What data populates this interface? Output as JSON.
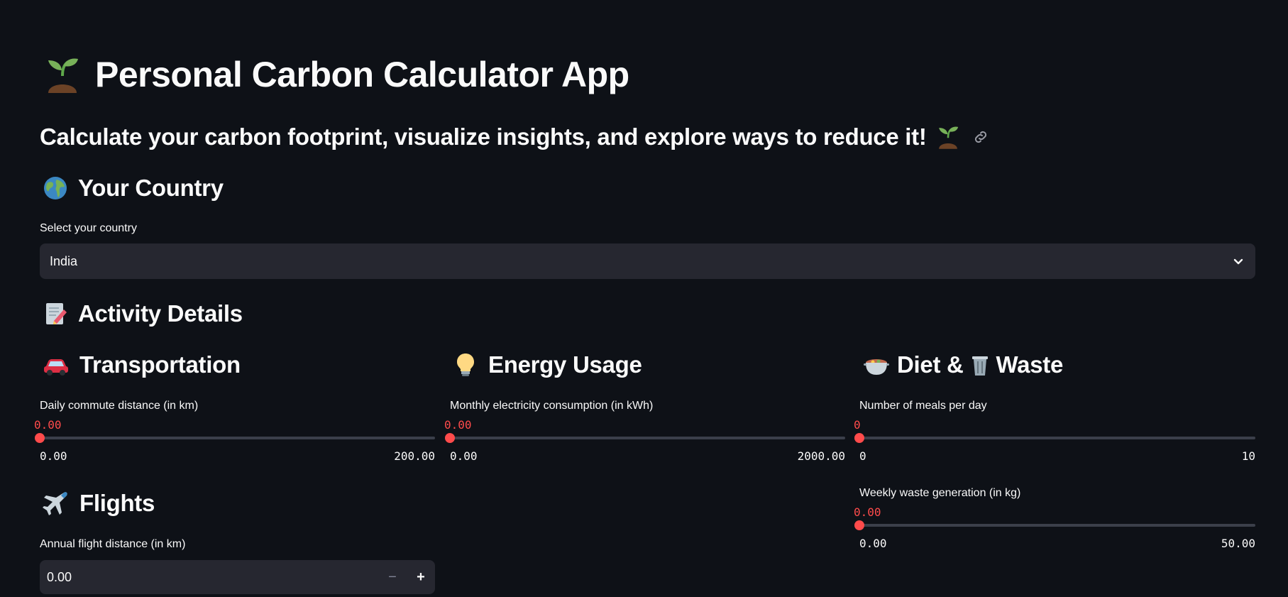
{
  "header": {
    "title": "Personal Carbon Calculator App",
    "subtitle": "Calculate your carbon footprint, visualize insights, and explore ways to reduce it!"
  },
  "country": {
    "heading": "Your Country",
    "label": "Select your country",
    "selected": "India"
  },
  "activity": {
    "heading": "Activity Details"
  },
  "transportation": {
    "heading": "Transportation",
    "label": "Daily commute distance (in km)",
    "value": "0.00",
    "min": "0.00",
    "max": "200.00",
    "fraction": 0
  },
  "energy": {
    "heading": "Energy Usage",
    "label": "Monthly electricity consumption (in kWh)",
    "value": "0.00",
    "min": "0.00",
    "max": "2000.00",
    "fraction": 0
  },
  "diet": {
    "heading": "Diet &",
    "heading2": "Waste",
    "meals": {
      "label": "Number of meals per day",
      "value": "0",
      "min": "0",
      "max": "10",
      "fraction": 0
    },
    "waste": {
      "label": "Weekly waste generation (in kg)",
      "value": "0.00",
      "min": "0.00",
      "max": "50.00",
      "fraction": 0
    }
  },
  "flights": {
    "heading": "Flights",
    "label": "Annual flight distance (in km)",
    "value": "0.00",
    "minus": "−",
    "plus": "+"
  },
  "icons": [
    "seedling-icon",
    "link-icon",
    "globe-icon",
    "memo-icon",
    "car-icon",
    "bulb-icon",
    "stew-icon",
    "wastebasket-icon",
    "airplane-icon",
    "chevron-down-icon"
  ],
  "colors": {
    "background": "#0e1117",
    "accent": "#ff4b4b",
    "input_bg": "#262730"
  }
}
